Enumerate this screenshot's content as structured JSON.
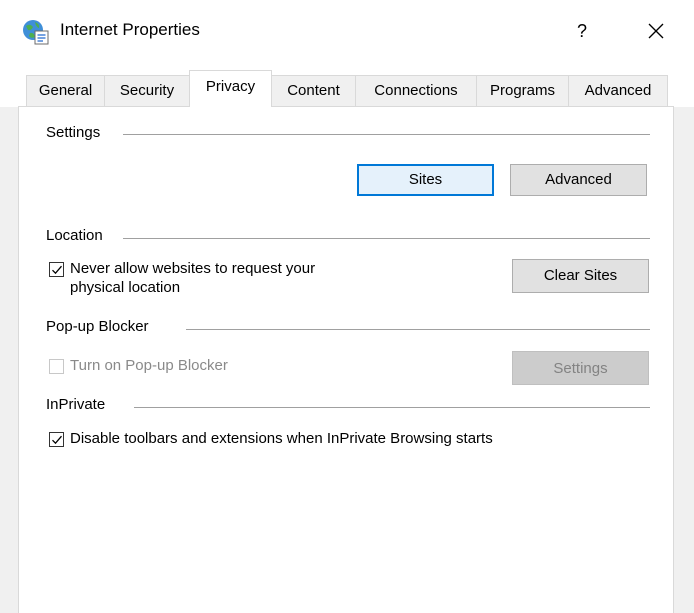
{
  "window": {
    "title": "Internet Properties",
    "help_label": "?",
    "close_label": "✕"
  },
  "tabs": [
    {
      "label": "General"
    },
    {
      "label": "Security"
    },
    {
      "label": "Privacy",
      "active": true
    },
    {
      "label": "Content"
    },
    {
      "label": "Connections"
    },
    {
      "label": "Programs"
    },
    {
      "label": "Advanced"
    }
  ],
  "settings": {
    "heading": "Settings",
    "sites_button": "Sites",
    "advanced_button": "Advanced"
  },
  "location": {
    "heading": "Location",
    "checkbox_label_line1": "Never allow websites to request your",
    "checkbox_label_line2": "physical location",
    "checked": true,
    "clear_sites_button": "Clear Sites"
  },
  "popup": {
    "heading": "Pop-up Blocker",
    "checkbox_label": "Turn on Pop-up Blocker",
    "checked": false,
    "settings_button": "Settings"
  },
  "inprivate": {
    "heading": "InPrivate",
    "checkbox_label": "Disable toolbars and extensions when InPrivate Browsing starts",
    "checked": true
  }
}
